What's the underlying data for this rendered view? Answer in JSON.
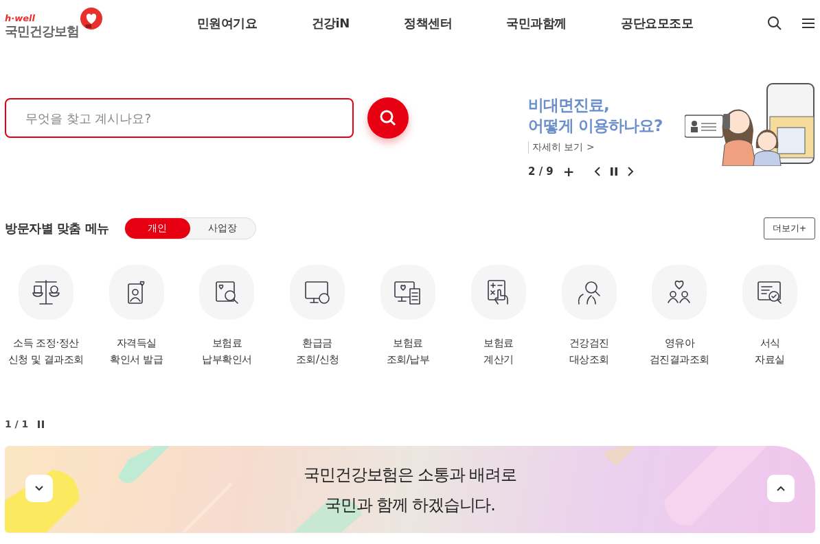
{
  "header": {
    "logo": {
      "tagline": "h·well",
      "name": "국민건강보험"
    },
    "nav": [
      {
        "label": "민원여기요"
      },
      {
        "label": "건강iN"
      },
      {
        "label": "정책센터"
      },
      {
        "label": "국민과함께"
      },
      {
        "label": "공단요모조모"
      }
    ]
  },
  "search": {
    "placeholder": "무엇을 찾고 계시나요?"
  },
  "promo": {
    "title": "비대면진료,\n어떻게 이용하나요?",
    "link": "자세히 보기 >",
    "counter": "2 / 9",
    "add": "+"
  },
  "visitor_menu": {
    "title": "방문자별 맞춤 메뉴",
    "tabs": [
      {
        "label": "개인",
        "selected": true
      },
      {
        "label": "사업장",
        "selected": false
      }
    ],
    "more": "더보기+",
    "items": [
      {
        "label": "소득 조정·정산\n신청 및 결과조회"
      },
      {
        "label": "자격득실\n확인서 발급"
      },
      {
        "label": "보험료\n납부확인서"
      },
      {
        "label": "환급금\n조회/신청"
      },
      {
        "label": "보험료\n조회/납부"
      },
      {
        "label": "보험료\n계산기"
      },
      {
        "label": "건강검진\n대상조회"
      },
      {
        "label": "영유아\n검진결과조회"
      },
      {
        "label": "서식\n자료실"
      }
    ],
    "pager": "1 / 1"
  },
  "slogan": {
    "text": "국민건강보험은 소통과 배려로\n국민과 함께 하겠습니다."
  }
}
